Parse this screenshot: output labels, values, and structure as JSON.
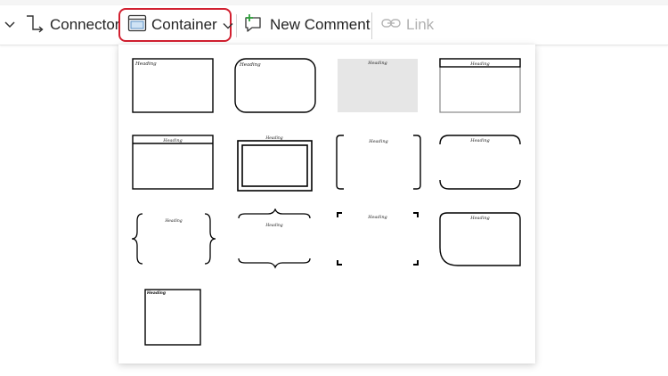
{
  "ribbon": {
    "connector_label": "Connector",
    "container_label": "Container",
    "new_comment_label": "New Comment",
    "link_label": "Link"
  },
  "colors": {
    "highlight_border": "#d22030",
    "comment_plus": "#2e9e3a",
    "disabled_text": "#b0b0b0"
  },
  "gallery": {
    "heading_text": "Heading"
  }
}
